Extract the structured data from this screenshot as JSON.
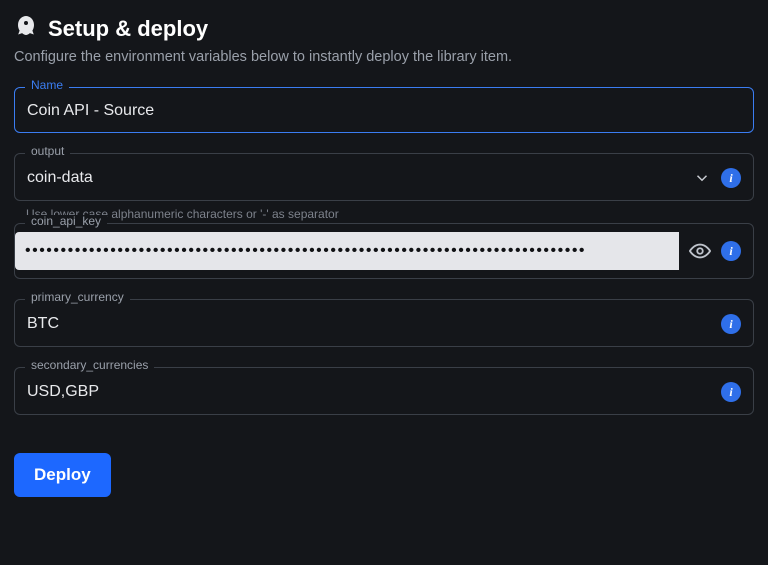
{
  "header": {
    "title": "Setup & deploy",
    "subtitle": "Configure the environment variables below to instantly deploy the library item."
  },
  "fields": {
    "name": {
      "label": "Name",
      "value": "Coin API - Source"
    },
    "output": {
      "label": "output",
      "value": "coin-data",
      "helper": "Use lower case alphanumeric characters or '-' as separator"
    },
    "coin_api_key": {
      "label": "coin_api_key",
      "masked_value": "•••••••••••••••••••••••••••••••••••••••••••••••••••••••••••••••••••••••••••••••"
    },
    "primary_currency": {
      "label": "primary_currency",
      "value": "BTC"
    },
    "secondary_currencies": {
      "label": "secondary_currencies",
      "value": "USD,GBP"
    }
  },
  "actions": {
    "deploy_label": "Deploy"
  },
  "icons": {
    "info_glyph": "i"
  }
}
